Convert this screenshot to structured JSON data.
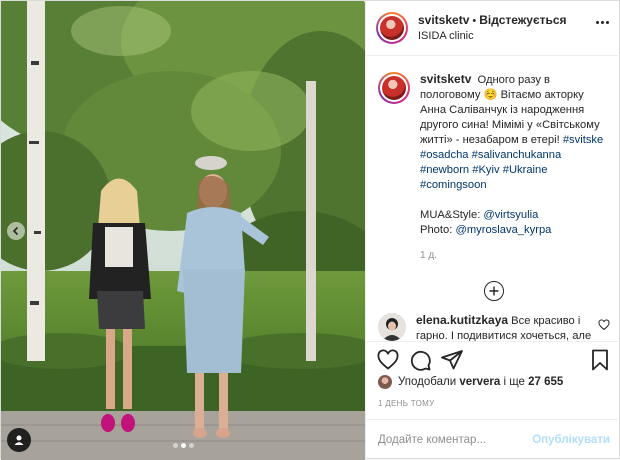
{
  "post": {
    "username": "svitsketv",
    "follow_label": "Відстежується",
    "location": "ISIDA clinic",
    "caption_text": "Одного разу в пологовому ☺️ Вітаємо акторку Анна Саліванчук із народження другого сина! Мімімі у «Світському житті» - незабаром в етері!",
    "hashtags": [
      "#svitske",
      "#osadcha",
      "#salivanchukanna",
      "#newborn",
      "#Kyiv",
      "#Ukraine",
      "#comingsoon"
    ],
    "credits_style_label": "MUA&Style:",
    "credits_style_user": "@virtsyulia",
    "credits_photo_label": "Photo:",
    "credits_photo_user": "@myroslava_kyrpa",
    "caption_time": "1 д.",
    "comment_user": "elena.kutitzkaya",
    "comment_text": "Все красиво і гарно. І подивитися хочеться, але слово \"етер\" просто",
    "likes_prefix": "Уподобали",
    "likes_user": "ververa",
    "likes_conjunction": "і ще",
    "likes_count": "27 655",
    "date": "1 ДЕНЬ ТОМУ",
    "comment_placeholder": "Додайте коментар...",
    "publish_label": "Опублікувати"
  },
  "icons": {
    "more": "more-options-icon",
    "load_more": "plus-circle-icon",
    "heart": "heart-icon",
    "comment": "comment-icon",
    "share": "share-icon",
    "bookmark": "bookmark-icon",
    "prev": "chevron-left-icon",
    "tag": "user-tag-icon"
  },
  "carousel": {
    "slides": 3,
    "active": 1
  },
  "colors": {
    "link": "#00376b",
    "muted": "#8e8e8e",
    "publish_disabled": "#b2dffc",
    "text": "#262626"
  }
}
